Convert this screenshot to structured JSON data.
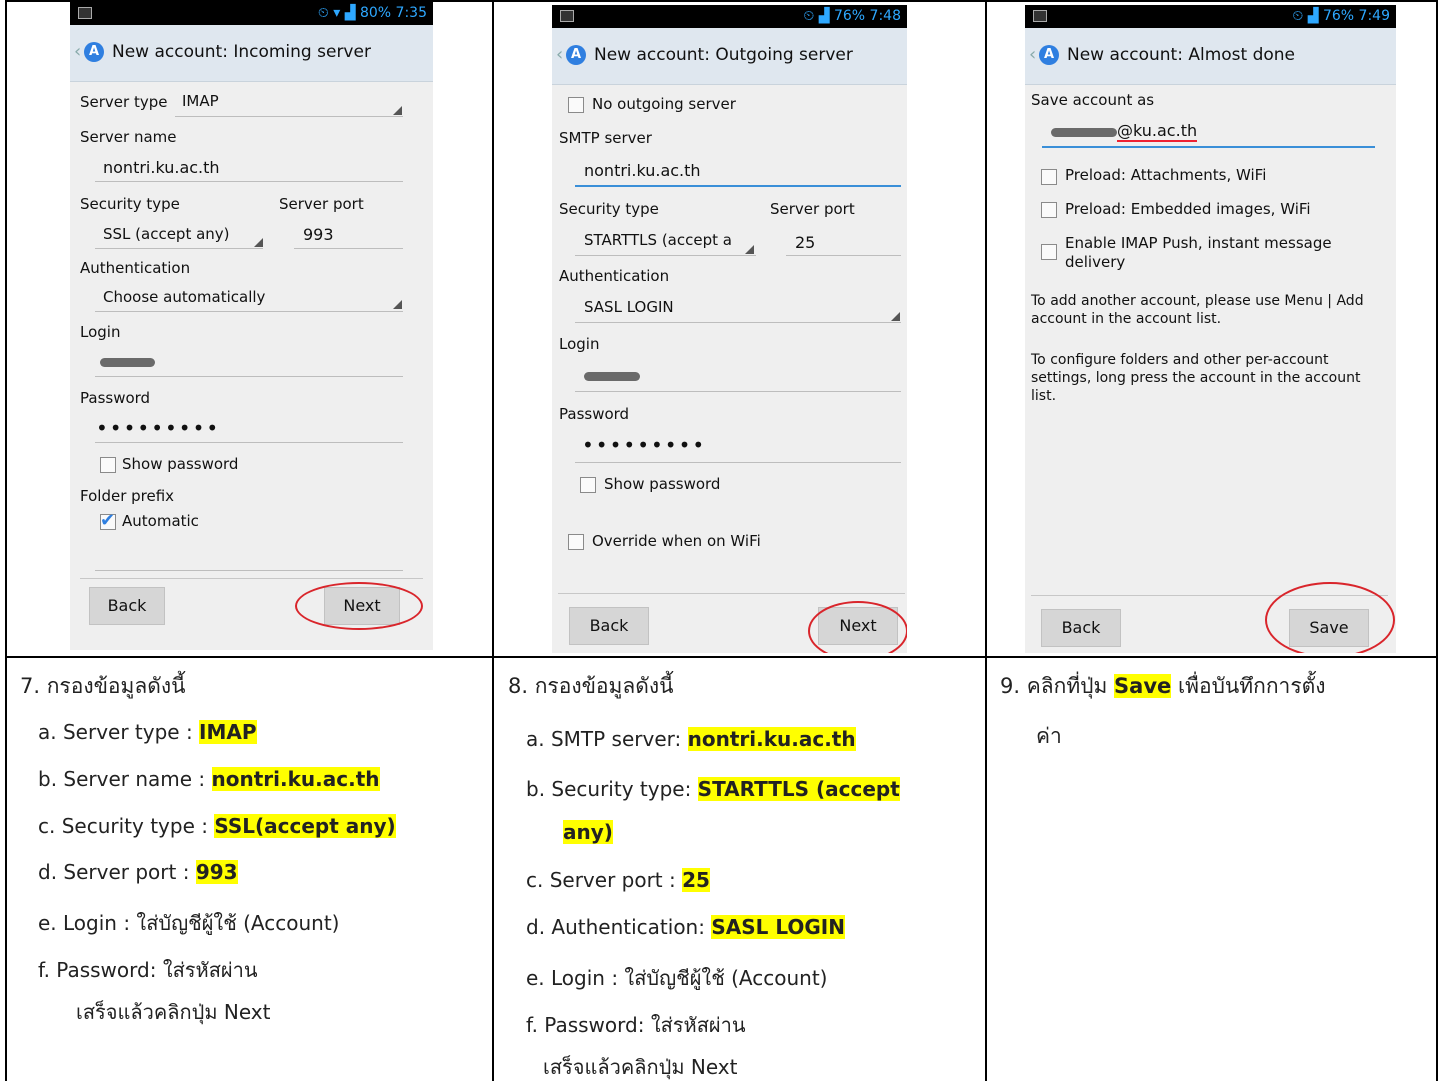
{
  "panel1": {
    "status": "80%  7:35",
    "title": "New account: Incoming server",
    "server_type_label": "Server type",
    "server_type_value": "IMAP",
    "server_name_label": "Server name",
    "server_name_value": "nontri.ku.ac.th",
    "security_type_label": "Security type",
    "security_type_value": "SSL (accept any)",
    "server_port_label": "Server port",
    "server_port_value": "993",
    "authentication_label": "Authentication",
    "authentication_value": "Choose automatically",
    "login_label": "Login",
    "password_label": "Password",
    "password_dots": "•••••••••",
    "show_password_label": "Show password",
    "folder_prefix_label": "Folder prefix",
    "automatic_label": "Automatic",
    "back_button": "Back",
    "next_button": "Next"
  },
  "panel2": {
    "status": "76%  7:48",
    "title": "New account: Outgoing server",
    "no_outgoing_label": "No outgoing server",
    "smtp_server_label": "SMTP server",
    "smtp_server_value": "nontri.ku.ac.th",
    "security_type_label": "Security type",
    "security_type_value": "STARTTLS (accept a",
    "server_port_label": "Server port",
    "server_port_value": "25",
    "authentication_label": "Authentication",
    "authentication_value": "SASL LOGIN",
    "login_label": "Login",
    "password_label": "Password",
    "password_dots": "•••••••••",
    "show_password_label": "Show password",
    "override_wifi_label": "Override when on WiFi",
    "back_button": "Back",
    "next_button": "Next"
  },
  "panel3": {
    "status": "76%  7:49",
    "title": "New account: Almost done",
    "save_account_as_label": "Save account as",
    "account_suffix": "@ku.ac.th",
    "preload_attachments": "Preload: Attachments, WiFi",
    "preload_images": "Preload: Embedded images, WiFi",
    "enable_push": "Enable IMAP Push, instant message delivery",
    "info_add_account": "To add another account, please use Menu | Add account in the account list.",
    "info_configure": "To configure folders and other per-account settings, long press the account in the account list.",
    "back_button": "Back",
    "save_button": "Save"
  },
  "step7": {
    "title": "7.  กรองข้อมูลดังนี้",
    "a_prefix": "a.  Server type : ",
    "a_value": "IMAP",
    "b_prefix": "b.  Server name : ",
    "b_value": "nontri.ku.ac.th",
    "c_prefix": "c.  Security type : ",
    "c_value": "SSL(accept any)",
    "d_prefix": "d.  Server port : ",
    "d_value": "993",
    "e_text": "e.  Login : ใส่บัญชีผู้ใช้ (Account)",
    "f_text": "f.   Password: ใส่รหัสผ่าน",
    "finish_text": "เสร็จแล้วคลิกปุ่ม Next"
  },
  "step8": {
    "title": "8.  กรองข้อมูลดังนี้",
    "a_prefix": "a.  SMTP server: ",
    "a_value": "nontri.ku.ac.th",
    "b_prefix": "b.  Security type: ",
    "b_value": "STARTTLS (accept",
    "b_value2": "any)",
    "c_prefix": "c.  Server port : ",
    "c_value": "25",
    "d_prefix": "d.  Authentication: ",
    "d_value": "SASL LOGIN",
    "e_text": "e.  Login : ใส่บัญชีผู้ใช้ (Account)",
    "f_text": "f.   Password: ใส่รหัสผ่าน",
    "finish_text": "เสร็จแล้วคลิกปุ่ม Next"
  },
  "step9": {
    "prefix": "9.  คลิกที่ปุ่ม ",
    "save_word": "Save",
    "suffix": " เพื่อบันทึกการตั้ง",
    "line2": "ค่า"
  }
}
